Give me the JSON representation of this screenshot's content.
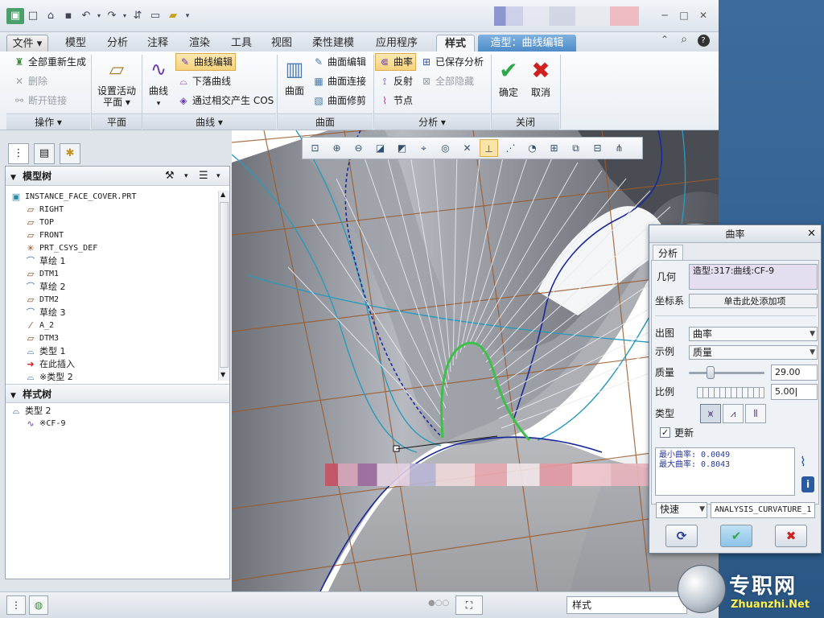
{
  "quick_access": [
    "new-icon",
    "open-icon",
    "save-icon",
    "undo-icon",
    "redo-icon",
    "regenerate-icon",
    "windows-icon",
    "folder-icon",
    "customize-icon"
  ],
  "tabs": [
    {
      "label": "文件 ▾"
    },
    {
      "label": "模型"
    },
    {
      "label": "分析"
    },
    {
      "label": "注释"
    },
    {
      "label": "渲染"
    },
    {
      "label": "工具"
    },
    {
      "label": "视图"
    },
    {
      "label": "柔性建模"
    },
    {
      "label": "应用程序"
    },
    {
      "label": "样式"
    },
    {
      "label": "造型：曲线编辑"
    }
  ],
  "ribbon": {
    "ops": {
      "regen": "全部重新生成",
      "delete": "删除",
      "break": "断开链接",
      "title": "操作 ▾"
    },
    "plane": {
      "active": "设置活动",
      "active2": "平面 ▾",
      "title": "平面"
    },
    "curve": {
      "big": "曲线",
      "edit": "曲线编辑",
      "drop": "下落曲线",
      "cos": "通过相交产生 COS",
      "title": "曲线 ▾"
    },
    "surface": {
      "big": "曲面",
      "edit": "曲面编辑",
      "connect": "曲面连接",
      "trim": "曲面修剪",
      "title": "曲面"
    },
    "analysis": {
      "curvature": "曲率",
      "saved": "已保存分析",
      "reflect": "反射",
      "hide_all": "全部隐藏",
      "node": "节点",
      "title": "分析 ▾"
    },
    "close": {
      "ok": "确定",
      "cancel": "取消",
      "title": "关闭"
    }
  },
  "model_tree": {
    "header": "模型树",
    "items": [
      {
        "label": "INSTANCE_FACE_COVER.PRT",
        "icon": "part-icon"
      },
      {
        "label": "RIGHT",
        "icon": "datum-plane-icon"
      },
      {
        "label": "TOP",
        "icon": "datum-plane-icon"
      },
      {
        "label": "FRONT",
        "icon": "datum-plane-icon"
      },
      {
        "label": "PRT_CSYS_DEF",
        "icon": "csys-icon"
      },
      {
        "label": "草绘 1",
        "icon": "sketch-icon"
      },
      {
        "label": "DTM1",
        "icon": "datum-plane-icon"
      },
      {
        "label": "草绘 2",
        "icon": "sketch-icon"
      },
      {
        "label": "DTM2",
        "icon": "datum-plane-icon"
      },
      {
        "label": "草绘 3",
        "icon": "sketch-icon"
      },
      {
        "label": "A_2",
        "icon": "axis-icon"
      },
      {
        "label": "DTM3",
        "icon": "datum-plane-icon"
      },
      {
        "label": "类型 1",
        "icon": "style-icon"
      },
      {
        "label": "在此插入",
        "icon": "insert-arrow-icon"
      },
      {
        "label": "※类型 2",
        "icon": "style-icon"
      }
    ]
  },
  "style_tree": {
    "header": "样式树",
    "items": [
      {
        "label": "类型 2"
      },
      {
        "label": "※CF-9"
      }
    ]
  },
  "status": {
    "filter": "样式"
  },
  "dialog": {
    "title": "曲率",
    "tab": "分析",
    "geometry_label": "几何",
    "geometry_value": "造型:317:曲线:CF-9",
    "csys_label": "坐标系",
    "csys_value": "单击此处添加项",
    "output_label": "出图",
    "output_value": "曲率",
    "example_label": "示例",
    "example_value": "质量",
    "quality_label": "质量",
    "quality_value": "29.00",
    "ratio_label": "比例",
    "ratio_value": "5.00",
    "type_label": "类型",
    "update_label": "更新",
    "min_curv": "最小曲率: 0.0049",
    "max_curv": "最大曲率: 0.8043",
    "mode_value": "快速",
    "name_value": "ANALYSIS_CURVATURE_1"
  },
  "watermark": {
    "cn": "专职网",
    "en": "Zhuanzhi.Net"
  }
}
